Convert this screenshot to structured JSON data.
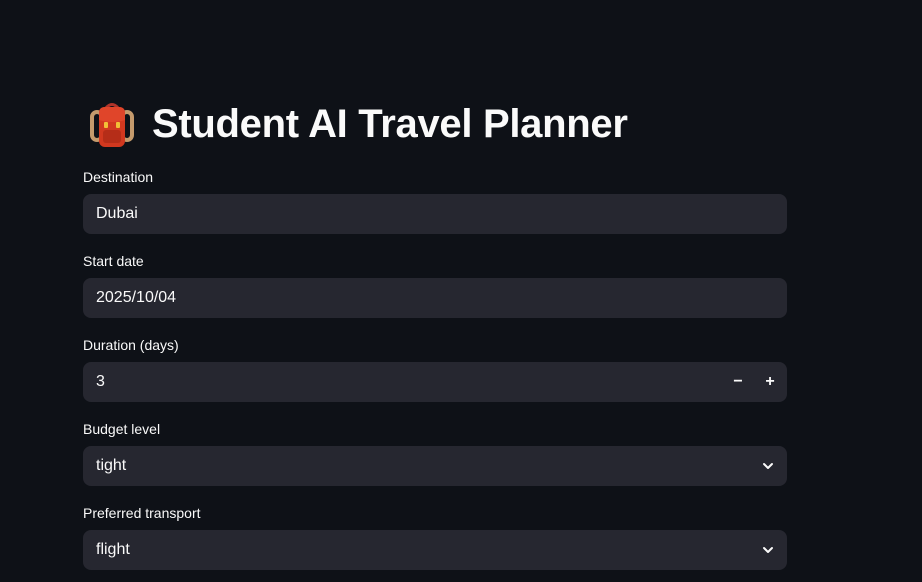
{
  "header": {
    "title": "Student AI Travel Planner",
    "icon": "backpack-icon"
  },
  "form": {
    "destination": {
      "label": "Destination",
      "value": "Dubai"
    },
    "start_date": {
      "label": "Start date",
      "value": "2025/10/04"
    },
    "duration": {
      "label": "Duration (days)",
      "value": "3",
      "decrement": "−",
      "increment": "+"
    },
    "budget": {
      "label": "Budget level",
      "value": "tight"
    },
    "transport": {
      "label": "Preferred transport",
      "value": "flight"
    }
  },
  "colors": {
    "background": "#0e1117",
    "input_background": "#262730",
    "text": "#fafafa",
    "backpack": "#d1381f"
  }
}
